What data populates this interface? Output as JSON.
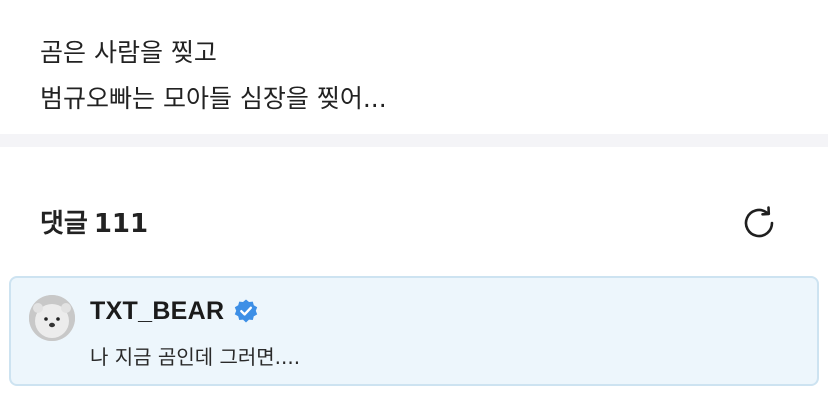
{
  "post": {
    "lines": [
      "곰은 사람을 찢고",
      "범규오빠는 모아들 심장을 찢어..."
    ]
  },
  "comments": {
    "label": "댓글",
    "count": "111",
    "refresh_icon": "refresh-icon"
  },
  "comment": {
    "author": "TXT_BEAR",
    "verified_icon": "verified-badge-icon",
    "text": "나 지금 곰인데 그러면....",
    "accent_color": "#3d8fe6"
  },
  "colors": {
    "card_background": "#edf6fc",
    "card_border": "#cde3f1",
    "divider": "#f4f4f7"
  }
}
